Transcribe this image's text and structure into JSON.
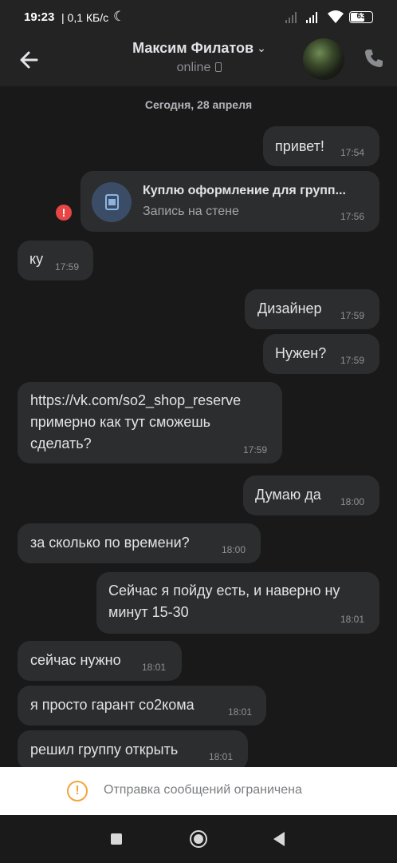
{
  "status_bar": {
    "time": "19:23",
    "speed": "| 0,1 КБ/с",
    "battery": "63",
    "moon_icon": "moon-icon",
    "signal_icon": "signal-icon",
    "wifi_icon": "wifi-icon"
  },
  "header": {
    "title": "Максим Филатов",
    "subtitle": "online",
    "back_icon": "back-arrow-icon",
    "call_icon": "phone-icon",
    "chevron_icon": "chevron-down-icon"
  },
  "chat": {
    "date": "Сегодня, 28 апреля",
    "messages": [
      {
        "text": "привет!",
        "time": "17:54",
        "out": true
      },
      {
        "type": "wall",
        "title": "Куплю оформление для групп...",
        "subtitle": "Запись на стене",
        "time": "17:56",
        "out": true,
        "error": "!"
      },
      {
        "text": "ку",
        "time": "17:59",
        "out": false
      },
      {
        "text": "Дизайнер",
        "time": "17:59",
        "out": true
      },
      {
        "text": "Нужен?",
        "time": "17:59",
        "out": true
      },
      {
        "link": "https://vk.com/so2_shop_reserve",
        "text": "примерно как тут сможешь\nсделать?",
        "time": "17:59",
        "out": false
      },
      {
        "text": "Думаю да",
        "time": "18:00",
        "out": true
      },
      {
        "text": "за сколько по времени?",
        "time": "18:00",
        "out": false
      },
      {
        "text": "Сейчас я пойду есть, и наверно ну\nминут 15-30",
        "time": "18:01",
        "out": true
      },
      {
        "text": "сейчас нужно",
        "time": "18:01",
        "out": false
      },
      {
        "text": "я просто гарант со2кома",
        "time": "18:01",
        "out": false
      },
      {
        "text": "решил группу открыть",
        "time": "18:01",
        "out": false
      }
    ]
  },
  "restriction": {
    "text": "Отправка сообщений ограничена",
    "icon": "warning-icon",
    "icon_glyph": "!"
  },
  "nav": {
    "recents_icon": "recents-icon",
    "home_icon": "home-icon",
    "back_icon": "back-triangle-icon"
  },
  "colors": {
    "background": "#19191a",
    "bubble": "#2c2d2e",
    "link": "#71aaeb",
    "warning": "#f2a53a",
    "error": "#e64646"
  }
}
